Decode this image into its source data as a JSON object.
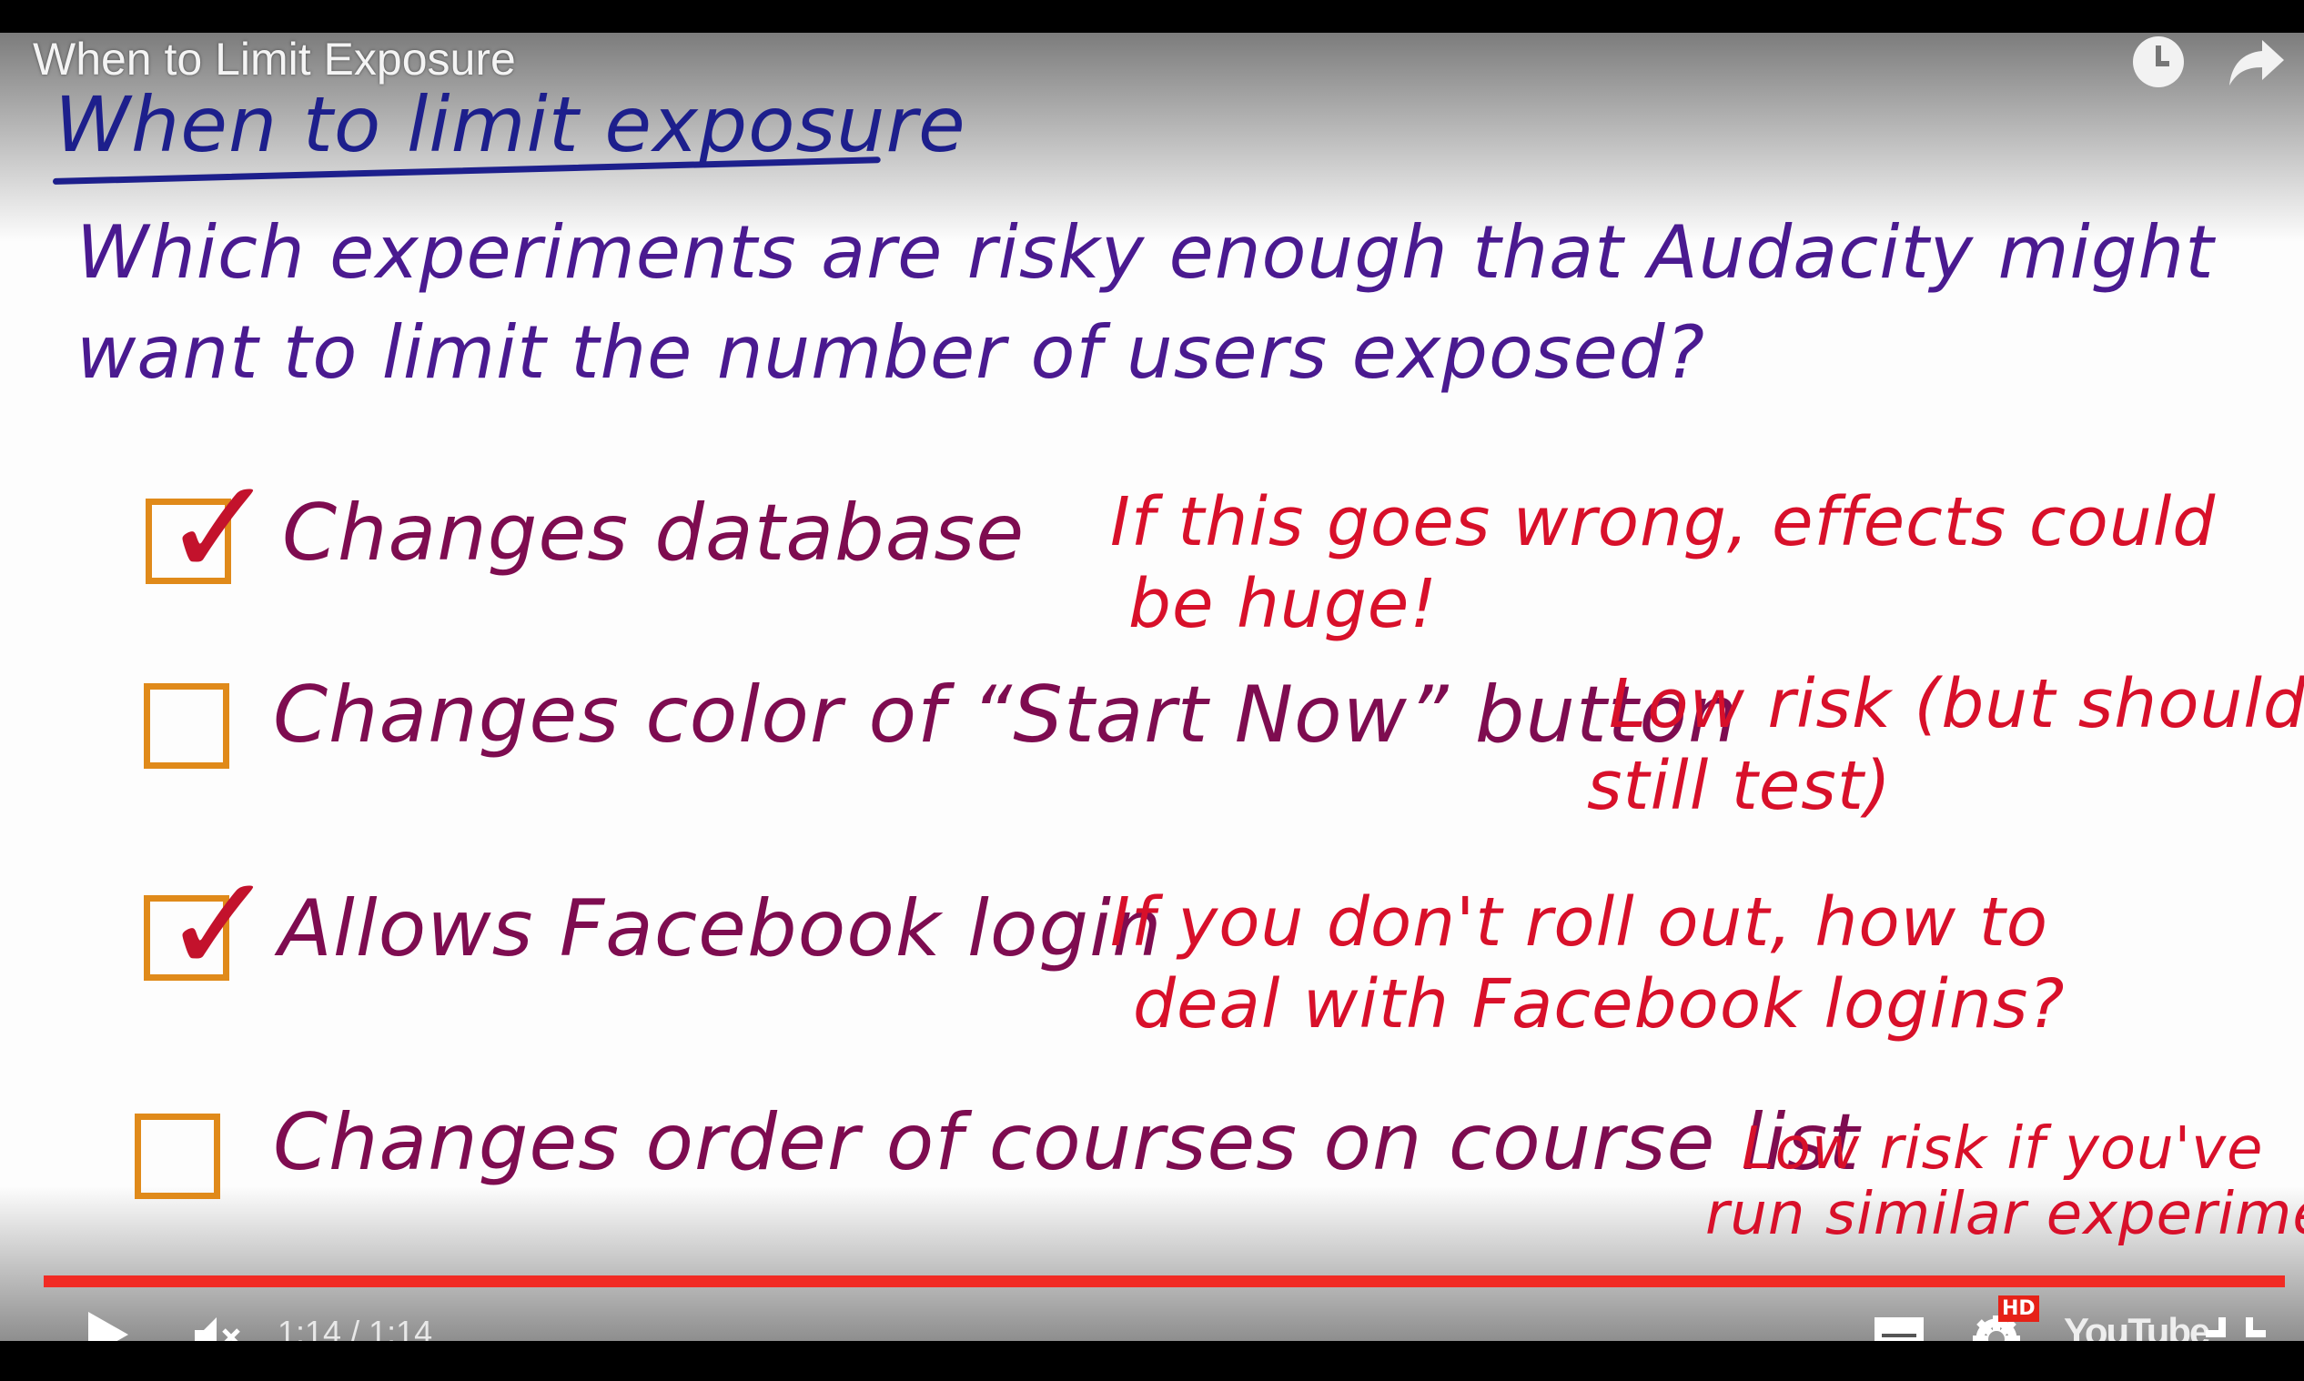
{
  "player": {
    "video_title": "When to Limit Exposure",
    "time_display": "1:14 / 1:14",
    "progress_fraction": 1.0,
    "hd_badge": "HD",
    "logo": "YouTube",
    "accent_color": "#f12b24"
  },
  "slide": {
    "heading": "When to limit exposure",
    "question_lines": [
      "Which experiments are risky enough that Audacity might",
      "want to limit the number of users exposed?"
    ],
    "items": [
      {
        "label": "Changes database",
        "checked": true,
        "note_lines": [
          "If this goes wrong, effects could",
          "be huge!"
        ]
      },
      {
        "label": "Changes color of “Start Now” button",
        "checked": false,
        "note_lines": [
          "Low risk (but should",
          "still test)"
        ]
      },
      {
        "label": "Allows Facebook login",
        "checked": true,
        "note_lines": [
          "If you don't roll out, how to",
          "deal with Facebook logins?"
        ]
      },
      {
        "label": "Changes order of courses on course list",
        "checked": false,
        "note_lines": [
          "Low risk if you've",
          "run similar experiments"
        ]
      }
    ]
  }
}
